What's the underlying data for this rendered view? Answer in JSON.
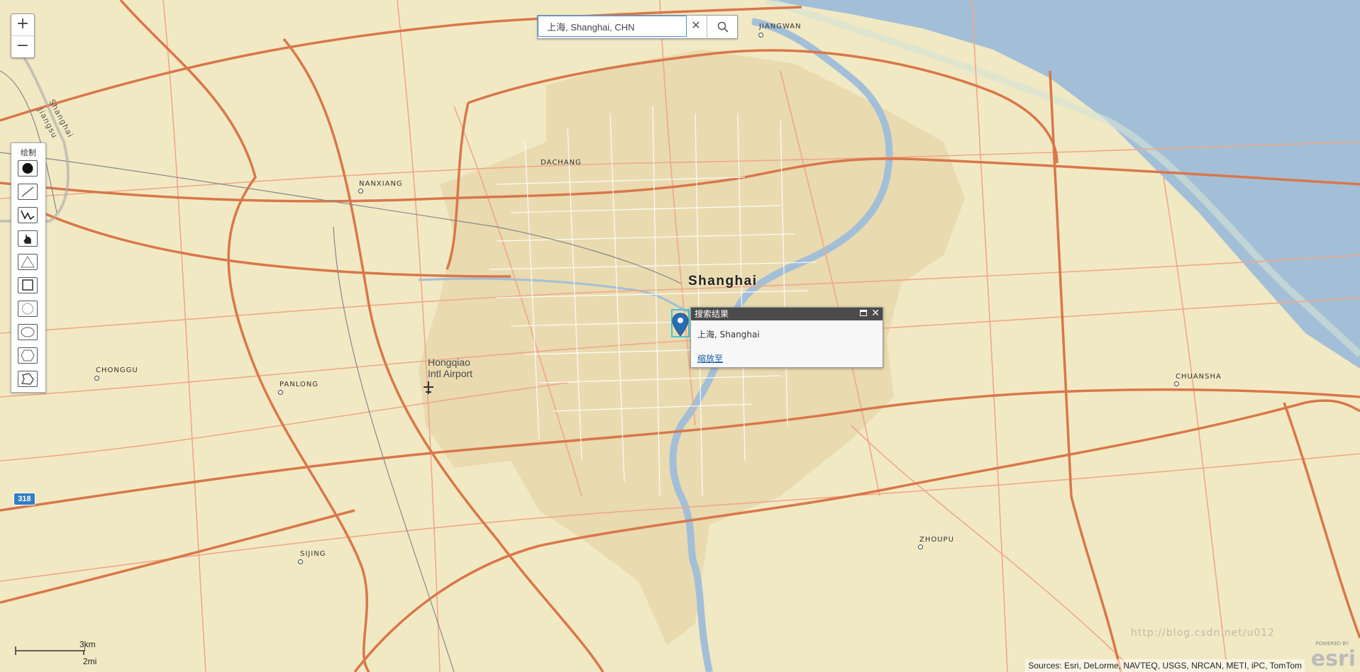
{
  "map": {
    "city": "Shanghai",
    "airport_line1": "Hongqiao",
    "airport_line2": "Intl Airport",
    "places": {
      "jiangwan": "JIANGWAN",
      "dachang": "DACHANG",
      "nanxiang": "NANXIANG",
      "chonggu": "CHONGGU",
      "panlong": "PANLONG",
      "sijing": "SIJING",
      "chuansha": "CHUANSHA",
      "zhoupu": "ZHOUPU"
    },
    "border_labels": {
      "shanghai": "Shanghai",
      "jiangsu": "Jiangsu"
    },
    "highway_shield": "318",
    "colors": {
      "land": "#f1e9c4",
      "urban": "#e8d8ae",
      "water": "#a3bfd8",
      "major_road": "#d9774a",
      "minor_road": "#f0a88a"
    }
  },
  "zoom": {
    "in_label": "+",
    "out_label": "−"
  },
  "search": {
    "value": "上海, Shanghai, CHN",
    "clear_icon": "close-icon",
    "search_icon": "search-icon"
  },
  "draw_toolbar": {
    "title": "绘制",
    "tools": [
      "point",
      "line",
      "polyline",
      "freehand-polyline",
      "triangle",
      "rectangle",
      "circle",
      "ellipse",
      "polygon",
      "freehand-polygon"
    ]
  },
  "popup": {
    "title": "搜索结果",
    "content": "上海, Shanghai",
    "zoom_link": "缩放至"
  },
  "scalebar": {
    "km": "3km",
    "mi": "2mi"
  },
  "attribution": "Sources: Esri, DeLorme, NAVTEQ, USGS, NRCAN, METI, iPC, TomTom",
  "watermark": "http://blog.csdn.net/u012",
  "esri_logo": {
    "powered": "POWERED BY",
    "name": "esri"
  }
}
